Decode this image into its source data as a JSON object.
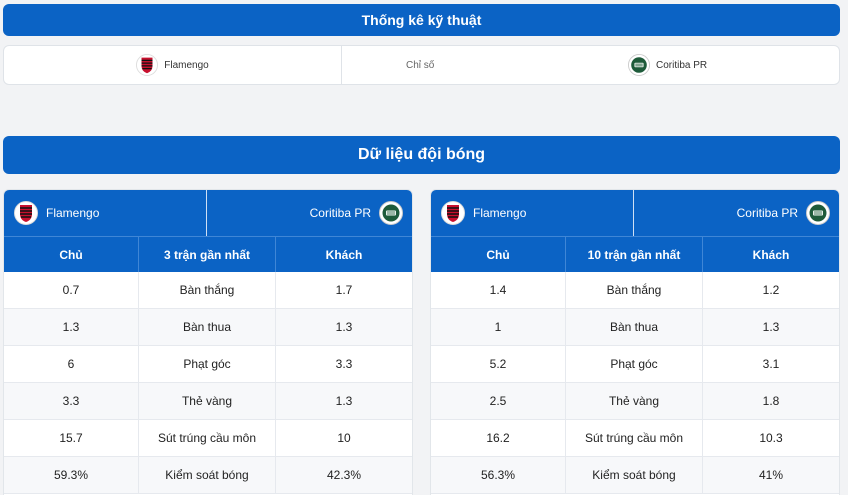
{
  "header": {
    "title": "Thống kê kỹ thuật"
  },
  "tech": {
    "home": "Flamengo",
    "middle": "Chỉ số",
    "away": "Coritiba PR"
  },
  "section": {
    "title": "Dữ liệu đội bóng"
  },
  "colors": {
    "accent": "#0b63c5"
  },
  "panels": [
    {
      "home": "Flamengo",
      "away": "Coritiba PR",
      "headers": [
        "Chủ",
        "3 trận gần nhất",
        "Khách"
      ],
      "rows": [
        [
          "0.7",
          "Bàn thắng",
          "1.7"
        ],
        [
          "1.3",
          "Bàn thua",
          "1.3"
        ],
        [
          "6",
          "Phạt góc",
          "3.3"
        ],
        [
          "3.3",
          "Thẻ vàng",
          "1.3"
        ],
        [
          "15.7",
          "Sút trúng cầu môn",
          "10"
        ],
        [
          "59.3%",
          "Kiểm soát bóng",
          "42.3%"
        ]
      ]
    },
    {
      "home": "Flamengo",
      "away": "Coritiba PR",
      "headers": [
        "Chủ",
        "10 trận gần nhất",
        "Khách"
      ],
      "rows": [
        [
          "1.4",
          "Bàn thắng",
          "1.2"
        ],
        [
          "1",
          "Bàn thua",
          "1.3"
        ],
        [
          "5.2",
          "Phạt góc",
          "3.1"
        ],
        [
          "2.5",
          "Thẻ vàng",
          "1.8"
        ],
        [
          "16.2",
          "Sút trúng cầu môn",
          "10.3"
        ],
        [
          "56.3%",
          "Kiểm soát bóng",
          "41%"
        ]
      ]
    }
  ]
}
